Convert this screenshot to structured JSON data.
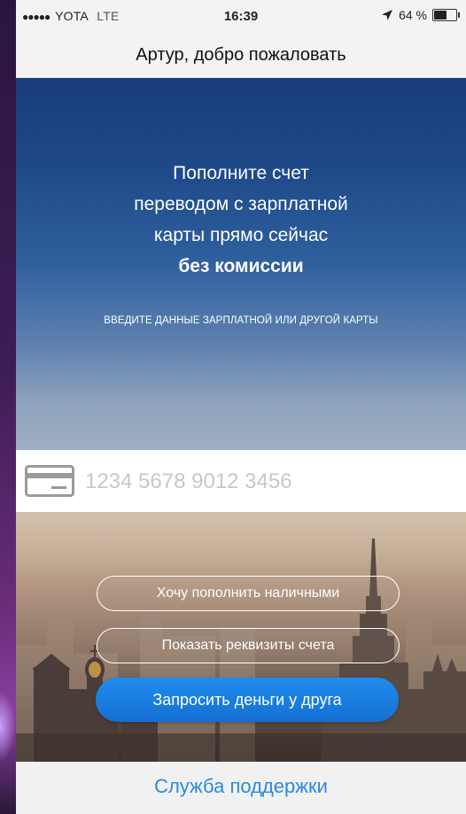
{
  "status_bar": {
    "signal_dots": "●●●●●",
    "carrier": "YOTA",
    "network": "LTE",
    "time": "16:39",
    "battery_text": "64 %",
    "battery_level": 0.64,
    "location_icon": "location-arrow-icon"
  },
  "header": {
    "title": "Артур, добро пожаловать"
  },
  "promo": {
    "line1": "Пополните счет",
    "line2": "переводом с зарплатной",
    "line3": "карты прямо сейчас",
    "line4": "без комиссии",
    "subtitle": "ВВЕДИТЕ ДАННЫЕ ЗАРПЛАТНОЙ ИЛИ ДРУГОЙ КАРТЫ"
  },
  "card": {
    "icon": "credit-card-icon",
    "placeholder": "1234 5678 9012 3456"
  },
  "actions": {
    "cash_label": "Хочу пополнить наличными",
    "details_label": "Показать реквизиты счета",
    "request_label": "Запросить деньги у друга"
  },
  "support": {
    "label": "Служба поддержки"
  },
  "colors": {
    "primary": "#1a7de0",
    "link": "#2a8ae0",
    "hero_top": "#193c7a"
  }
}
